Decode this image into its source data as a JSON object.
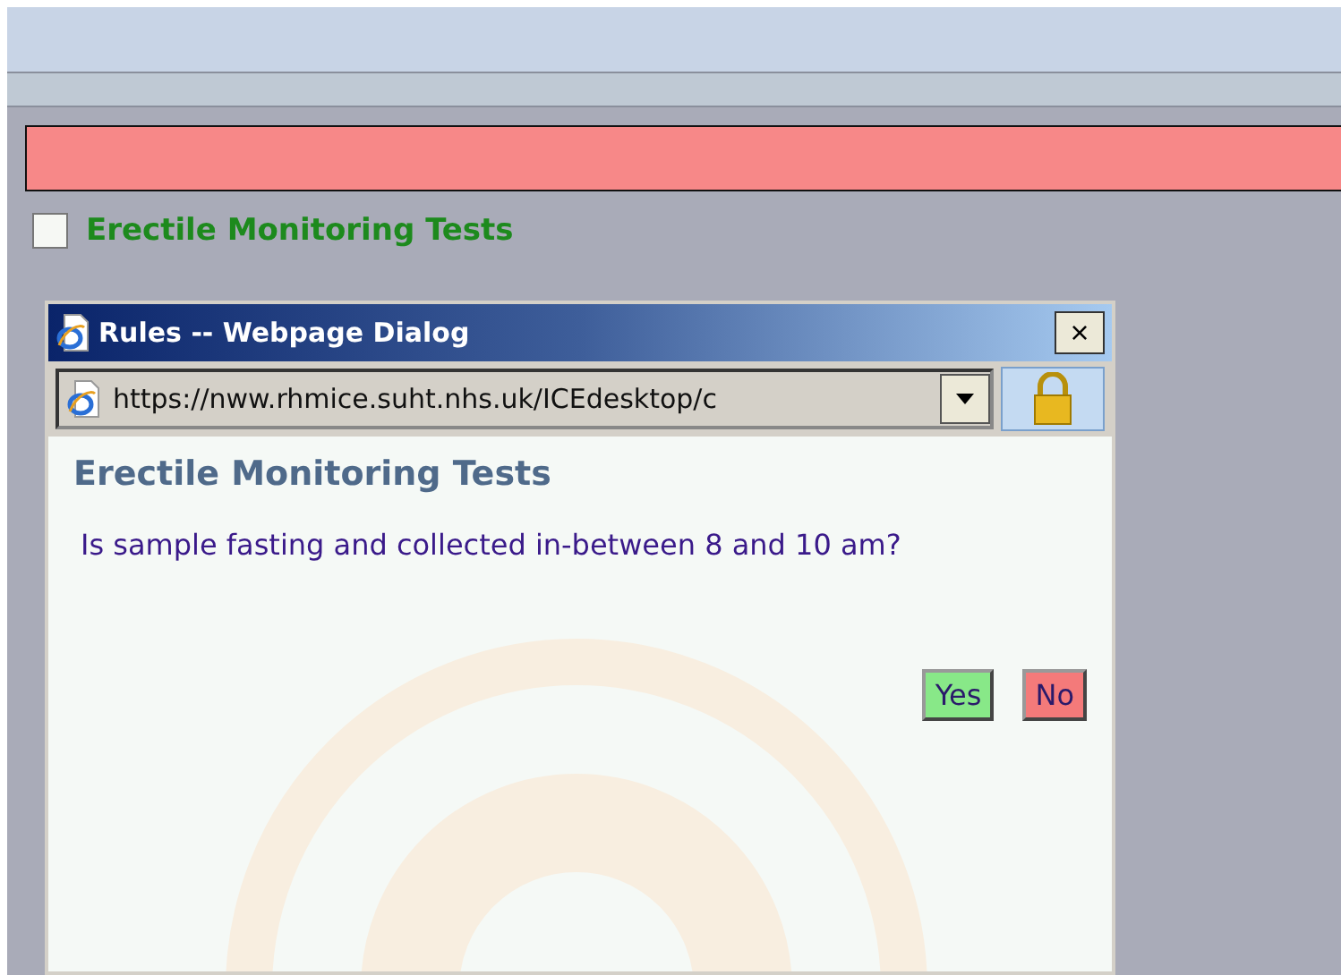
{
  "page": {
    "checkbox": {
      "label": "Erectile Monitoring Tests",
      "checked": false
    }
  },
  "dialog": {
    "title": "Rules -- Webpage Dialog",
    "address": "https://nww.rhmice.suht.nhs.uk/ICEdesktop/c",
    "close": "×",
    "heading": "Erectile Monitoring Tests",
    "question": "Is sample fasting and collected in-between 8 and 10 am?",
    "buttons": [
      {
        "label": "Yes",
        "color": "#88e888"
      },
      {
        "label": "No",
        "color": "#f47a7a"
      }
    ]
  }
}
